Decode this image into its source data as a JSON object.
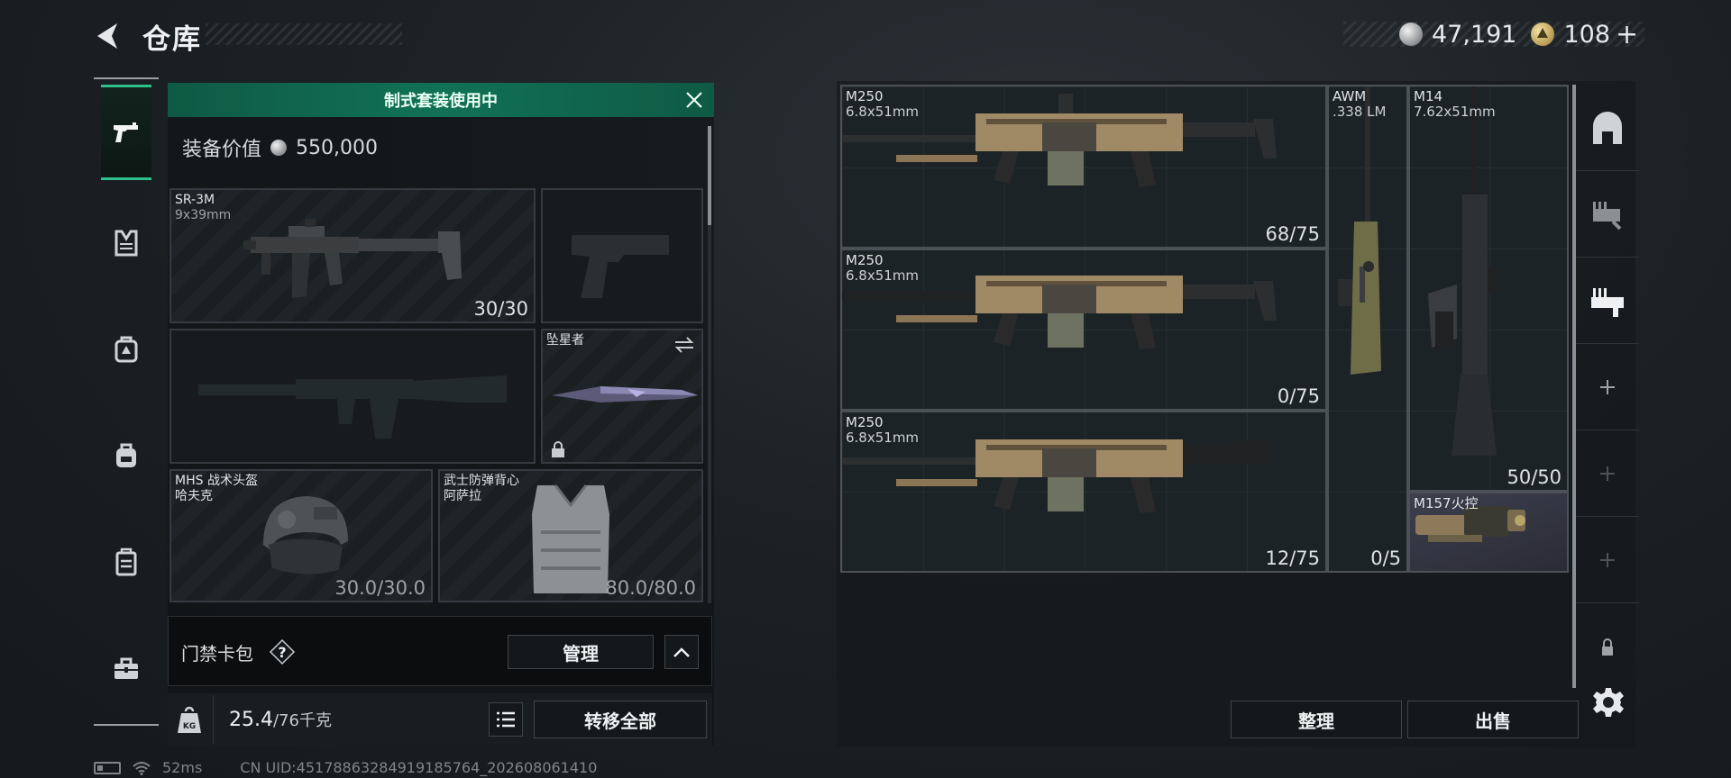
{
  "header": {
    "title": "仓库",
    "currency_primary": "47,191",
    "currency_secondary": "108",
    "add_label": "+"
  },
  "left_rail": {
    "items": [
      {
        "icon": "pistol-icon",
        "active": true
      },
      {
        "icon": "vest-icon",
        "active": false
      },
      {
        "icon": "backpack-hazard-icon",
        "active": false
      },
      {
        "icon": "backpack-icon",
        "active": false
      },
      {
        "icon": "case-icon",
        "active": false
      },
      {
        "icon": "toolbox-icon",
        "active": false
      }
    ]
  },
  "loadout": {
    "banner": "制式套装使用中",
    "value_label": "装备价值",
    "value_amount": "550,000",
    "slots": {
      "primary": {
        "name": "SR-3M",
        "caliber": "9x39mm",
        "ammo": "30/30"
      },
      "sidearm": {
        "name": "",
        "ammo": ""
      },
      "secondary": {
        "name": "",
        "ammo": ""
      },
      "melee": {
        "name": "坠星者"
      },
      "helmet": {
        "name": "MHS 战术头盔",
        "sub": "哈夫克",
        "durability": "30.0/30.0"
      },
      "armor": {
        "name": "武士防弹背心",
        "sub": "阿萨拉",
        "durability": "80.0/80.0"
      }
    },
    "card_bag_label": "门禁卡包",
    "help_label": "?",
    "manage_label": "管理",
    "weight_current": "25.4",
    "weight_capacity": "/76千克",
    "transfer_all_label": "转移全部"
  },
  "status_bar": {
    "ping": "52ms",
    "uid": "CN UID:4517886328491918576​4_202608061410"
  },
  "storage": {
    "items": [
      {
        "name": "M250",
        "caliber": "6.8x51mm",
        "ammo": "68/75"
      },
      {
        "name": "M250",
        "caliber": "6.8x51mm",
        "ammo": "0/75"
      },
      {
        "name": "M250",
        "caliber": "6.8x51mm",
        "ammo": "12/75"
      },
      {
        "name": "AWM",
        "caliber": ".338 LM",
        "ammo": "0/5"
      },
      {
        "name": "M14",
        "caliber": "7.62x51mm",
        "ammo": "50/50"
      },
      {
        "name": "M157火控",
        "caliber": "",
        "ammo": ""
      }
    ],
    "sort_label": "整理",
    "sell_label": "出售"
  },
  "right_rail": {
    "items": [
      "vault-icon",
      "weapon-parts-icon",
      "weapon-gear-icon",
      "add-slot-icon",
      "add-slot-icon",
      "add-slot-icon",
      "lock-icon"
    ]
  },
  "colors": {
    "accent_green": "#117255",
    "active_border": "#2fbf8a",
    "background": "#1c2125"
  }
}
